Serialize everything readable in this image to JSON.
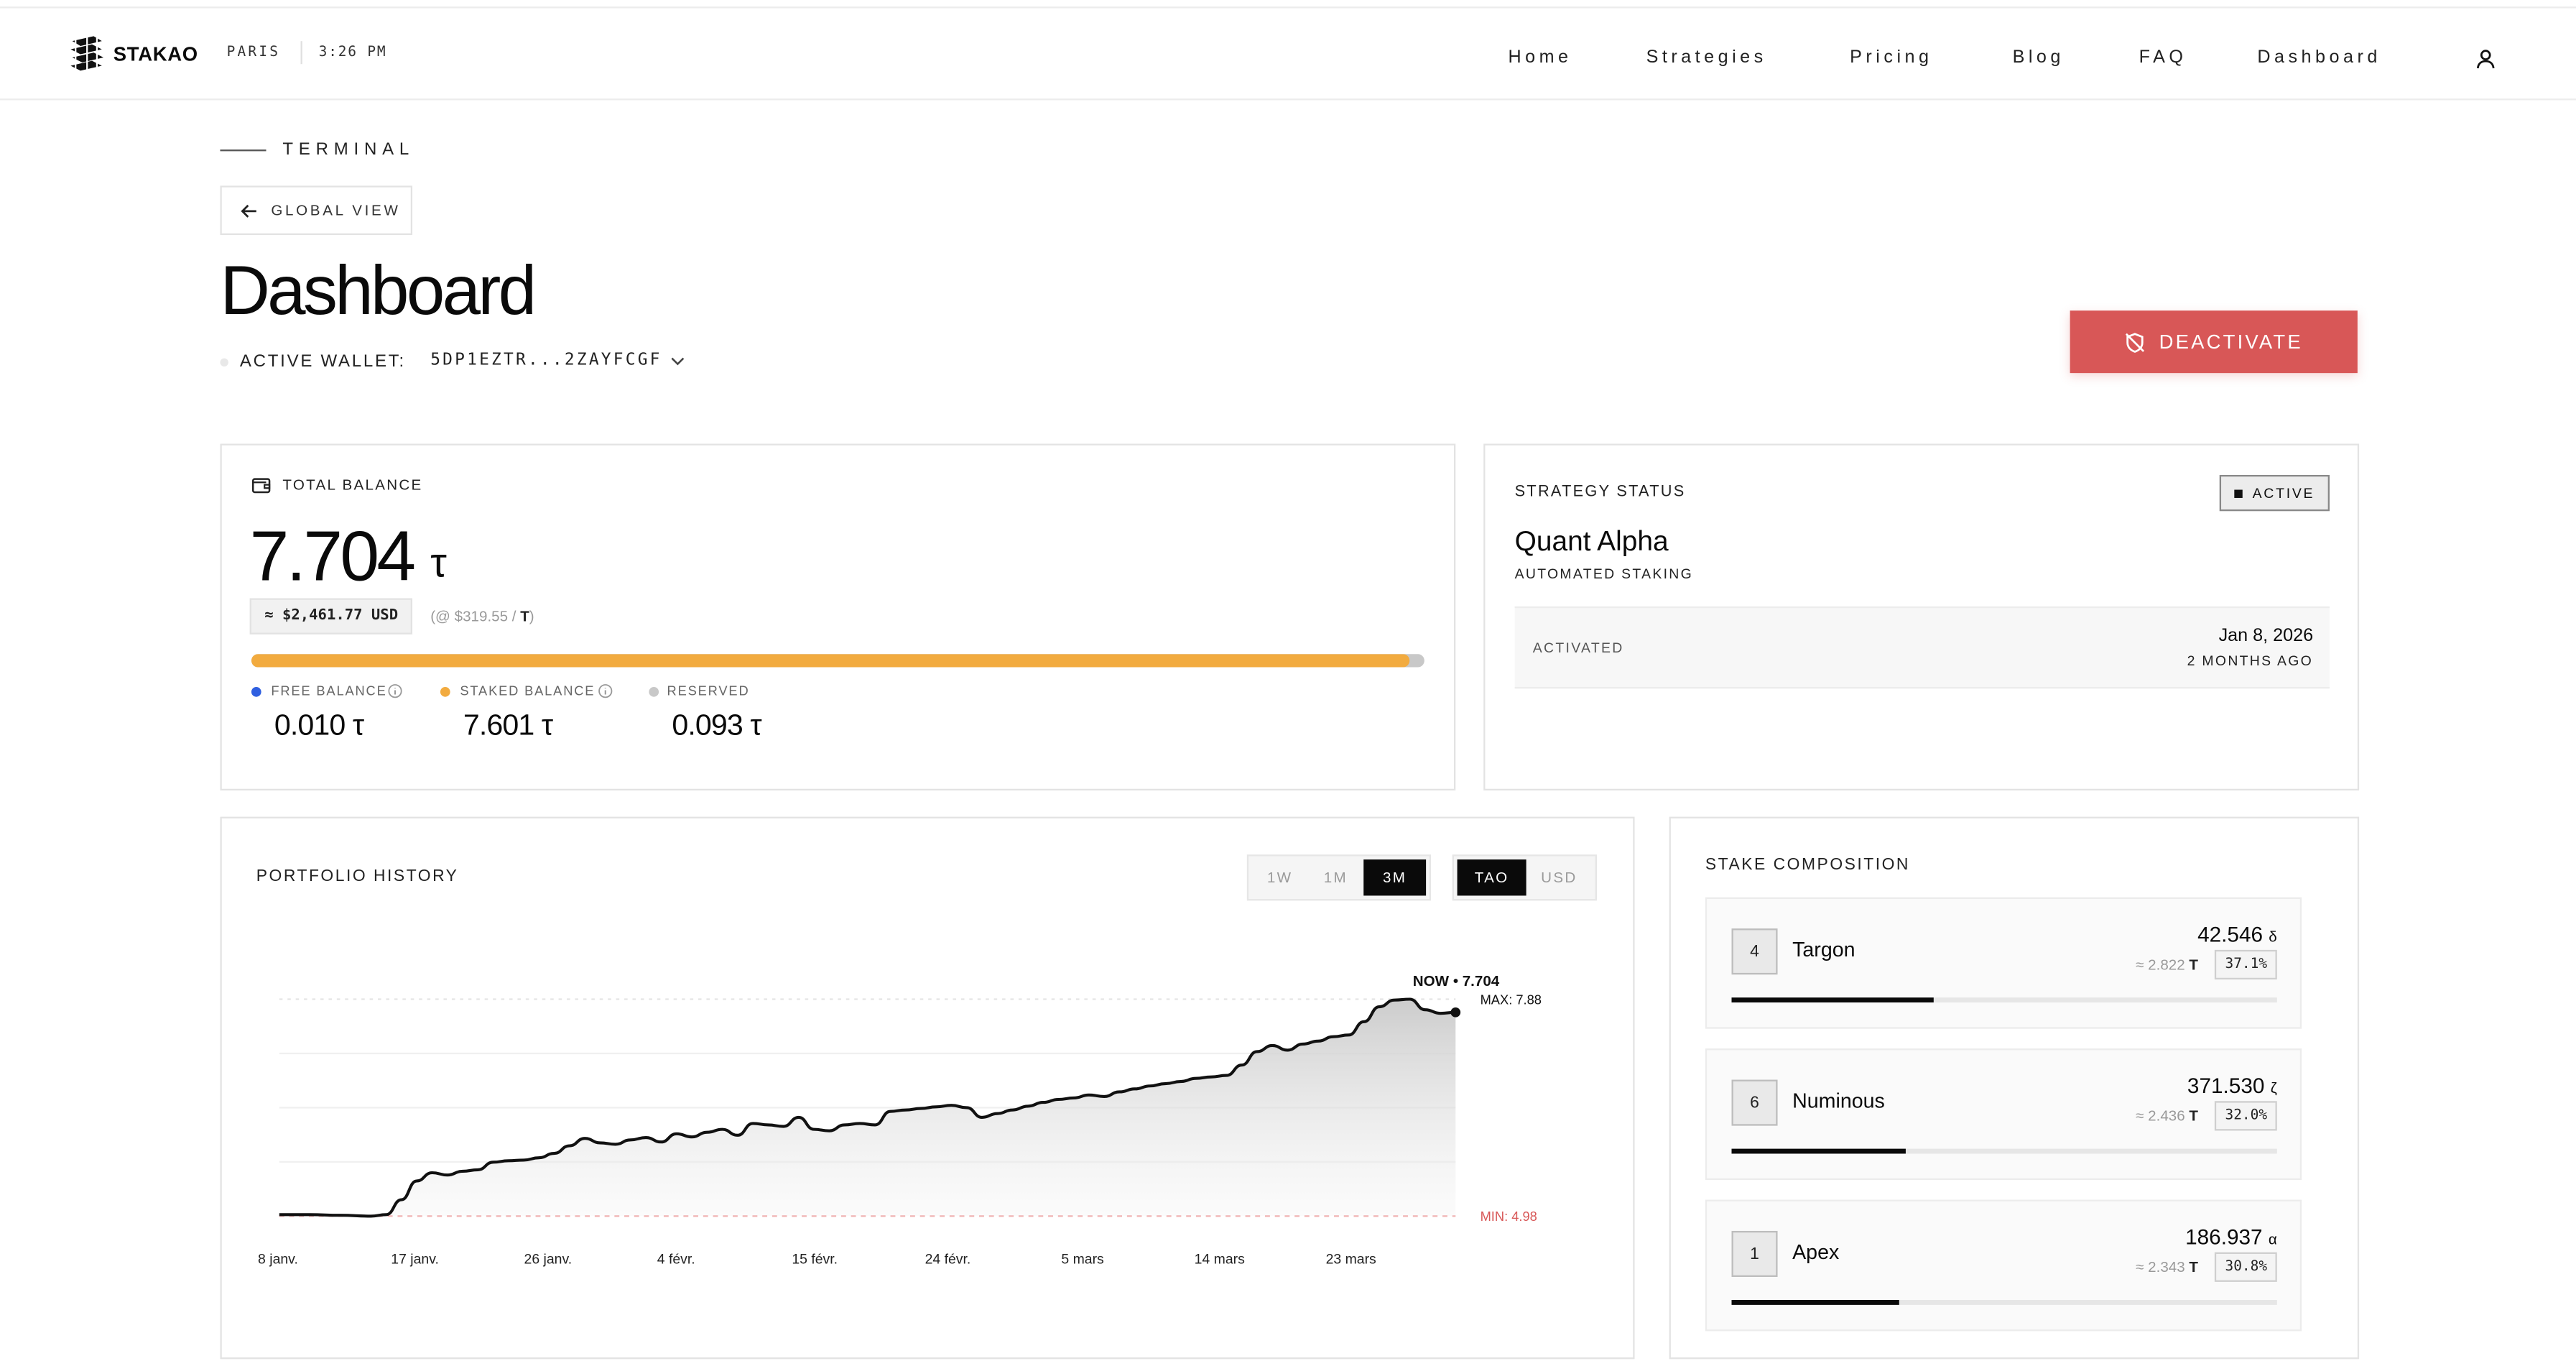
{
  "header": {
    "brand": "STAKAO",
    "city": "PARIS",
    "time": "3:26 PM",
    "nav": [
      "Home",
      "Strategies",
      "Pricing",
      "Blog",
      "FAQ",
      "Dashboard"
    ]
  },
  "page": {
    "section": "TERMINAL",
    "back_button": "GLOBAL VIEW",
    "title": "Dashboard",
    "wallet_label": "ACTIVE WALLET:",
    "wallet_value": "5DP1EZTR...2ZAYFCGF",
    "deactivate_label": "DEACTIVATE"
  },
  "balance": {
    "label": "TOTAL BALANCE",
    "amount": "7.704",
    "unit": "τ",
    "usd": "≈ $2,461.77 USD",
    "rate_prefix": "(@ $319.55 / ",
    "rate_unit": "T",
    "rate_suffix": ")",
    "allocation": {
      "free": 0.01,
      "staked": 7.601,
      "reserved": 0.093,
      "total": 7.704
    },
    "legend": [
      {
        "label": "FREE BALANCE",
        "value": "0.010 τ",
        "color": "#2f5fe0"
      },
      {
        "label": "STAKED BALANCE",
        "value": "7.601 τ",
        "color": "#f2ab3f"
      },
      {
        "label": "RESERVED",
        "value": "0.093 τ",
        "color": "#c8c8c8"
      }
    ]
  },
  "strategy": {
    "label": "STRATEGY STATUS",
    "status": "ACTIVE",
    "name": "Quant Alpha",
    "subtitle": "AUTOMATED STAKING",
    "activated_label": "ACTIVATED",
    "activated_date": "Jan 8, 2026",
    "activated_ago": "2 MONTHS AGO"
  },
  "portfolio": {
    "label": "PORTFOLIO HISTORY",
    "ranges": [
      "1W",
      "1M",
      "3M"
    ],
    "active_range": "3M",
    "currencies": [
      "TAO",
      "USD"
    ],
    "active_currency": "TAO"
  },
  "chart_data": {
    "type": "area",
    "title": "",
    "x_ticks": [
      "8 janv.",
      "17 janv.",
      "26 janv.",
      "4 févr.",
      "15 févr.",
      "24 févr.",
      "5 mars",
      "14 mars",
      "23 mars"
    ],
    "x_range": [
      "8 janv.",
      "25 mars"
    ],
    "ylim": [
      4.98,
      7.88
    ],
    "now_label": "NOW • 7.704",
    "max_label": "MAX: 7.88",
    "min_label": "MIN: 4.98",
    "grid": true,
    "series": [
      {
        "values": [
          [
            0,
            5.0
          ],
          [
            2,
            5.0
          ],
          [
            4,
            4.99
          ],
          [
            6,
            4.98
          ],
          [
            7,
            5.0
          ],
          [
            8,
            5.2
          ],
          [
            9,
            5.45
          ],
          [
            10,
            5.56
          ],
          [
            11,
            5.53
          ],
          [
            12,
            5.58
          ],
          [
            13,
            5.6
          ],
          [
            14,
            5.7
          ],
          [
            15,
            5.72
          ],
          [
            16,
            5.73
          ],
          [
            17,
            5.76
          ],
          [
            18,
            5.82
          ],
          [
            19,
            5.92
          ],
          [
            20,
            6.02
          ],
          [
            21,
            5.96
          ],
          [
            22,
            5.94
          ],
          [
            23,
            6.0
          ],
          [
            24,
            6.03
          ],
          [
            25,
            5.97
          ],
          [
            26,
            6.08
          ],
          [
            27,
            6.04
          ],
          [
            28,
            6.1
          ],
          [
            29,
            6.14
          ],
          [
            30,
            6.06
          ],
          [
            31,
            6.22
          ],
          [
            32,
            6.2
          ],
          [
            33,
            6.18
          ],
          [
            34,
            6.3
          ],
          [
            35,
            6.14
          ],
          [
            36,
            6.12
          ],
          [
            37,
            6.2
          ],
          [
            38,
            6.22
          ],
          [
            39,
            6.2
          ],
          [
            40,
            6.38
          ],
          [
            41,
            6.4
          ],
          [
            42,
            6.42
          ],
          [
            43,
            6.44
          ],
          [
            44,
            6.46
          ],
          [
            45,
            6.43
          ],
          [
            46,
            6.3
          ],
          [
            47,
            6.35
          ],
          [
            48,
            6.4
          ],
          [
            49,
            6.45
          ],
          [
            50,
            6.5
          ],
          [
            51,
            6.54
          ],
          [
            52,
            6.56
          ],
          [
            53,
            6.6
          ],
          [
            54,
            6.58
          ],
          [
            55,
            6.64
          ],
          [
            56,
            6.68
          ],
          [
            57,
            6.72
          ],
          [
            58,
            6.75
          ],
          [
            59,
            6.78
          ],
          [
            60,
            6.82
          ],
          [
            61,
            6.84
          ],
          [
            62,
            6.86
          ],
          [
            63,
            7.0
          ],
          [
            64,
            7.18
          ],
          [
            65,
            7.26
          ],
          [
            66,
            7.2
          ],
          [
            67,
            7.28
          ],
          [
            68,
            7.32
          ],
          [
            69,
            7.38
          ],
          [
            70,
            7.4
          ],
          [
            71,
            7.58
          ],
          [
            72,
            7.78
          ],
          [
            73,
            7.87
          ],
          [
            74,
            7.88
          ],
          [
            75,
            7.74
          ],
          [
            76,
            7.69
          ],
          [
            77,
            7.704
          ]
        ]
      }
    ]
  },
  "stake": {
    "label": "STAKE COMPOSITION",
    "items": [
      {
        "rank": "4",
        "name": "Targon",
        "amount": "42.546",
        "symbol": "δ",
        "tao": "≈ 2.822",
        "tao_unit": "T",
        "pct": "37.1%",
        "share": 0.371
      },
      {
        "rank": "6",
        "name": "Numinous",
        "amount": "371.530",
        "symbol": "ζ",
        "tao": "≈ 2.436",
        "tao_unit": "T",
        "pct": "32.0%",
        "share": 0.32
      },
      {
        "rank": "1",
        "name": "Apex",
        "amount": "186.937",
        "symbol": "α",
        "tao": "≈ 2.343",
        "tao_unit": "T",
        "pct": "30.8%",
        "share": 0.308
      }
    ]
  }
}
